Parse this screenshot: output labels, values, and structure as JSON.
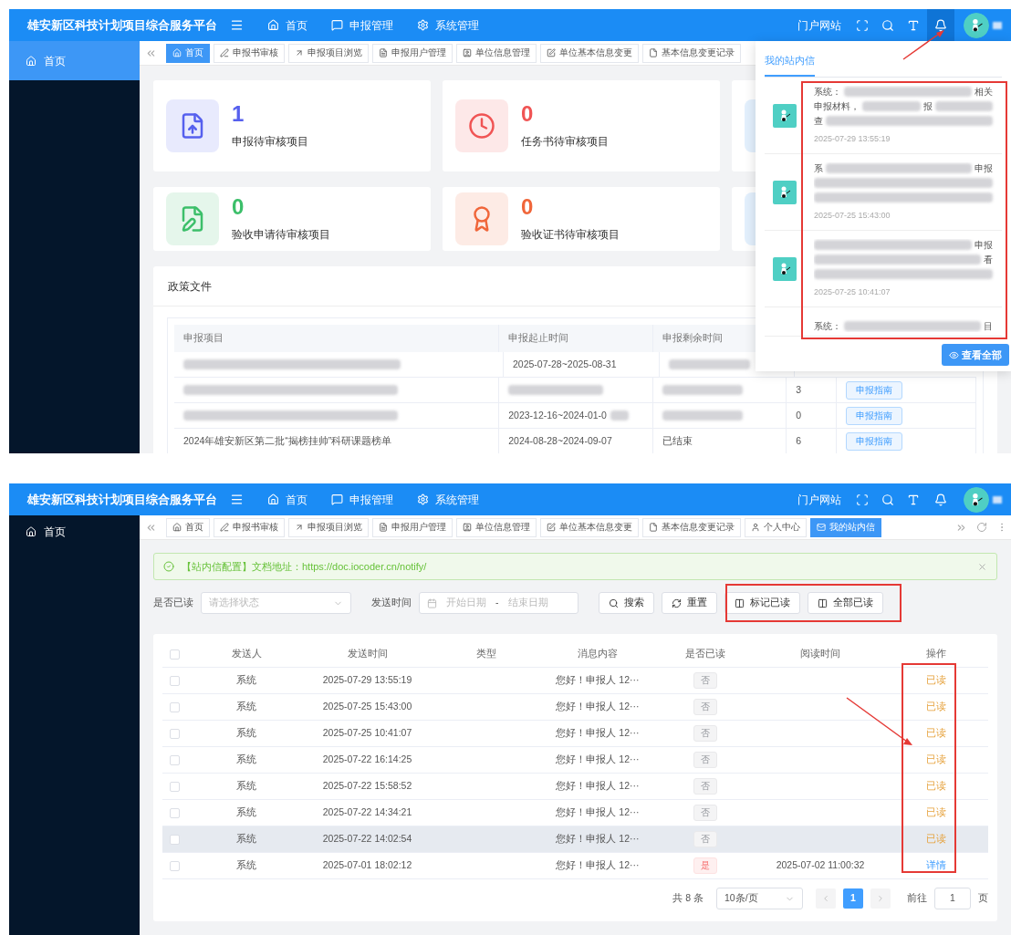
{
  "top_screen": {
    "header": {
      "title": "雄安新区科技计划项目综合服务平台",
      "nav": [
        {
          "label": "首页"
        },
        {
          "label": "申报管理"
        },
        {
          "label": "系统管理"
        }
      ],
      "portal_link": "门户网站",
      "bell_active": true
    },
    "sidebar": {
      "items": [
        {
          "label": "首页",
          "selected": true
        }
      ]
    },
    "tabs": [
      {
        "label": "首页",
        "selected": true
      },
      {
        "label": "申报书审核",
        "selected": false
      },
      {
        "label": "申报项目浏览",
        "selected": false
      },
      {
        "label": "申报用户管理",
        "selected": false
      },
      {
        "label": "单位信息管理",
        "selected": false
      },
      {
        "label": "单位基本信息变更",
        "selected": false
      },
      {
        "label": "基本信息变更记录",
        "selected": false
      }
    ],
    "stat_cards": [
      {
        "count": "1",
        "label": "申报待审核项目",
        "color": "#5660ee"
      },
      {
        "count": "0",
        "label": "任务书待审核项目",
        "color": "#f05454"
      },
      {
        "color": "#e3f0fd"
      },
      {
        "count": "0",
        "label": "验收申请待审核项目",
        "color": "#3cbf6a"
      },
      {
        "count": "0",
        "label": "验收证书待审核项目",
        "color": "#f0663a"
      },
      {
        "color": "#e3f0fd"
      }
    ],
    "policy": {
      "title": "政策文件",
      "columns": [
        "申报项目",
        "申报起止时间",
        "申报剩余时间"
      ],
      "rows": [
        [
          {
            "kind": "blurred"
          },
          {
            "kind": "text",
            "text": "2025-07-28~2025-08-31"
          },
          {
            "kind": "blurred"
          }
        ],
        [
          {
            "kind": "blurred"
          },
          {
            "kind": "blurred"
          },
          {
            "kind": "blurred"
          },
          {
            "kind": "text",
            "text": "3"
          },
          {
            "kind": "button",
            "text": "申报指南"
          }
        ],
        [
          {
            "kind": "blurred"
          },
          {
            "kind": "partly_blurred",
            "text": "2023-12-16~2024-01-0"
          },
          {
            "kind": "blurred"
          },
          {
            "kind": "text",
            "text": "0"
          },
          {
            "kind": "button",
            "text": "申报指南"
          }
        ],
        [
          {
            "kind": "text",
            "text": "2024年雄安新区第二批“揭榜挂帅”科研课题榜单"
          },
          {
            "kind": "text",
            "text": "2024-08-28~2024-09-07"
          },
          {
            "kind": "text",
            "text": "已结束"
          },
          {
            "kind": "text",
            "text": "6"
          },
          {
            "kind": "button",
            "text": "申报指南"
          }
        ]
      ]
    },
    "message_popup": {
      "tab": "我的站内信",
      "messages": [
        {
          "lines": [
            [
              {
                "kind": "text",
                "text": "系统："
              },
              {
                "kind": "blur"
              },
              {
                "kind": "text",
                "text": "相关"
              }
            ],
            [
              {
                "kind": "text",
                "text": "申报材料，"
              },
              {
                "kind": "blur"
              },
              {
                "kind": "text",
                "text": "报"
              },
              {
                "kind": "blur"
              }
            ],
            [
              {
                "kind": "text",
                "text": "查"
              },
              {
                "kind": "blur"
              }
            ]
          ],
          "time": "2025-07-29 13:55:19"
        },
        {
          "lines": [
            [
              {
                "kind": "text",
                "text": "系"
              },
              {
                "kind": "blur"
              },
              {
                "kind": "text",
                "text": "申报"
              }
            ],
            [
              {
                "kind": "blur"
              }
            ],
            [
              {
                "kind": "blur"
              }
            ]
          ],
          "time": "2025-07-25 15:43:00"
        },
        {
          "lines": [
            [
              {
                "kind": "blur"
              },
              {
                "kind": "text",
                "text": "申报"
              }
            ],
            [
              {
                "kind": "blur"
              },
              {
                "kind": "text",
                "text": "看"
              }
            ],
            [
              {
                "kind": "blur"
              }
            ]
          ],
          "time": "2025-07-25 10:41:07"
        },
        {
          "lines": [
            [
              {
                "kind": "text",
                "text": "系统："
              },
              {
                "kind": "blur"
              },
              {
                "kind": "text",
                "text": "目"
              }
            ]
          ]
        }
      ],
      "view_all": "查看全部"
    }
  },
  "bottom_screen": {
    "header": {
      "title": "雄安新区科技计划项目综合服务平台",
      "nav": [
        {
          "label": "首页"
        },
        {
          "label": "申报管理"
        },
        {
          "label": "系统管理"
        }
      ],
      "portal_link": "门户网站",
      "bell_active": false
    },
    "sidebar": {
      "items": [
        {
          "label": "首页",
          "selected": false
        }
      ]
    },
    "tabs": [
      {
        "label": "首页",
        "selected": false
      },
      {
        "label": "申报书审核",
        "selected": false
      },
      {
        "label": "申报项目浏览",
        "selected": false
      },
      {
        "label": "申报用户管理",
        "selected": false
      },
      {
        "label": "单位信息管理",
        "selected": false
      },
      {
        "label": "单位基本信息变更",
        "selected": false
      },
      {
        "label": "基本信息变更记录",
        "selected": false
      },
      {
        "label": "个人中心",
        "selected": false
      },
      {
        "label": "我的站内信",
        "selected": true
      }
    ],
    "alert": "【站内信配置】文档地址：https://doc.iocoder.cn/notify/",
    "filter": {
      "read_label": "是否已读",
      "read_placeholder": "请选择状态",
      "time_label": "发送时间",
      "start_placeholder": "开始日期",
      "separator": "-",
      "end_placeholder": "结束日期",
      "buttons": [
        {
          "label": "搜索"
        },
        {
          "label": "重置"
        },
        {
          "label": "标记已读"
        },
        {
          "label": "全部已读"
        }
      ]
    },
    "table": {
      "select_all_checked": false,
      "columns": [
        "发送人",
        "发送时间",
        "类型",
        "消息内容",
        "是否已读",
        "阅读时间",
        "操作"
      ],
      "rows": [
        {
          "checked": false,
          "highlighted": false,
          "sender": "系统",
          "time": "2025-07-29 13:55:19",
          "content": "您好！申报人 12···",
          "read": false,
          "read_label": "否",
          "action": "已读"
        },
        {
          "checked": false,
          "highlighted": false,
          "sender": "系统",
          "time": "2025-07-25 15:43:00",
          "content": "您好！申报人 12···",
          "read": false,
          "read_label": "否",
          "action": "已读"
        },
        {
          "checked": false,
          "highlighted": false,
          "sender": "系统",
          "time": "2025-07-25 10:41:07",
          "content": "您好！申报人 12···",
          "read": false,
          "read_label": "否",
          "action": "已读"
        },
        {
          "checked": false,
          "highlighted": false,
          "sender": "系统",
          "time": "2025-07-22 16:14:25",
          "content": "您好！申报人 12···",
          "read": false,
          "read_label": "否",
          "action": "已读"
        },
        {
          "checked": false,
          "highlighted": false,
          "sender": "系统",
          "time": "2025-07-22 15:58:52",
          "content": "您好！申报人 12···",
          "read": false,
          "read_label": "否",
          "action": "已读"
        },
        {
          "checked": false,
          "highlighted": false,
          "sender": "系统",
          "time": "2025-07-22 14:34:21",
          "content": "您好！申报人 12···",
          "read": false,
          "read_label": "否",
          "action": "已读"
        },
        {
          "checked": false,
          "highlighted": true,
          "sender": "系统",
          "time": "2025-07-22 14:02:54",
          "content": "您好！申报人 12···",
          "read": false,
          "read_label": "否",
          "action": "已读"
        },
        {
          "checked": false,
          "highlighted": false,
          "sender": "系统",
          "time": "2025-07-01 18:02:12",
          "content": "您好！申报人 12···",
          "read": true,
          "read_label": "是",
          "read_time": "2025-07-02 11:00:32",
          "action": "详情"
        }
      ]
    },
    "pagination": {
      "total": "共 8 条",
      "page_size": "10条/页",
      "pages": [
        {
          "label": "1",
          "selected": true
        }
      ],
      "goto_label": "前往",
      "goto_value": "1",
      "page_unit": "页"
    }
  }
}
